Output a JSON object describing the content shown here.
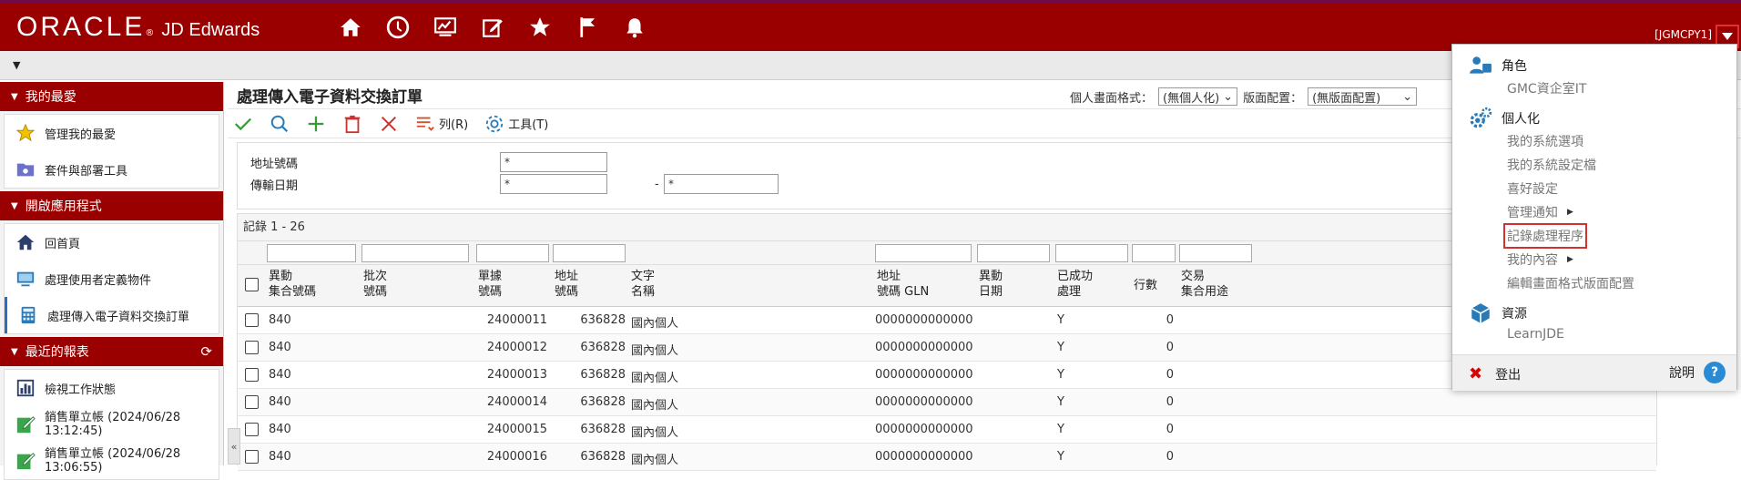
{
  "header": {
    "logo_oracle": "ORACLE",
    "logo_reg": "®",
    "logo_product": "JD Edwards",
    "environment": "[JGMCPY1]",
    "nav_icons": [
      "home-icon",
      "clock-icon",
      "monitor-chart-icon",
      "edit-icon",
      "star-icon",
      "flag-icon",
      "bell-icon"
    ]
  },
  "sidebar": {
    "favorites": {
      "title": "我的最愛",
      "items": [
        {
          "label": "管理我的最愛",
          "icon": "star-icon"
        },
        {
          "label": "套件與部署工具",
          "icon": "folder-icon"
        }
      ]
    },
    "open_apps": {
      "title": "開啟應用程式",
      "items": [
        {
          "label": "回首頁",
          "icon": "home-icon"
        },
        {
          "label": "處理使用者定義物件",
          "icon": "monitor-icon"
        },
        {
          "label": "處理傳入電子資料交換訂單",
          "icon": "calculator-icon"
        }
      ]
    },
    "recent_reports": {
      "title": "最近的報表",
      "items": [
        {
          "label": "檢視工作狀態",
          "icon": "bar-chart-icon"
        },
        {
          "label": "銷售單立帳 (2024/06/28 13:12:45)",
          "icon": "edit-report-icon"
        },
        {
          "label": "銷售單立帳 (2024/06/28 13:06:55)",
          "icon": "edit-report-icon"
        }
      ]
    }
  },
  "main": {
    "title": "處理傳入電子資料交換訂單",
    "personal_format_label": "個人畫面格式：",
    "personal_format_value": "(無個人化)",
    "layout_label": "版面配置：",
    "layout_value": "(無版面配置)",
    "toolbar": {
      "row_label": "列(R)",
      "tools_label": "工具(T)"
    },
    "filters": {
      "address_label": "地址號碼",
      "address_value": "*",
      "date_label": "傳輸日期",
      "date_from": "*",
      "date_to": "*",
      "dash": "-"
    },
    "records": "記錄 1 - 26",
    "columns": [
      "異動\n集合號碼",
      "批次\n號碼",
      "單據\n號碼",
      "地址\n號碼",
      "文字\n名稱",
      "地址\n號碼 GLN",
      "異動\n日期",
      "已成功\n處理",
      "行數",
      "交易\n集合用途"
    ],
    "rows": [
      [
        "840",
        "",
        "24000011",
        "636828",
        "國內個人",
        "0000000000000",
        "",
        "Y",
        "0",
        ""
      ],
      [
        "840",
        "",
        "24000012",
        "636828",
        "國內個人",
        "0000000000000",
        "",
        "Y",
        "0",
        ""
      ],
      [
        "840",
        "",
        "24000013",
        "636828",
        "國內個人",
        "0000000000000",
        "",
        "Y",
        "0",
        ""
      ],
      [
        "840",
        "",
        "24000014",
        "636828",
        "國內個人",
        "0000000000000",
        "",
        "Y",
        "0",
        ""
      ],
      [
        "840",
        "",
        "24000015",
        "636828",
        "國內個人",
        "0000000000000",
        "",
        "Y",
        "0",
        ""
      ],
      [
        "840",
        "",
        "24000016",
        "636828",
        "國內個人",
        "0000000000000",
        "",
        "Y",
        "0",
        ""
      ]
    ]
  },
  "menu": {
    "role_title": "角色",
    "role_value": "GMC資企室IT",
    "personalize_title": "個人化",
    "personalize_items": [
      "我的系統選項",
      "我的系統設定檔",
      "喜好設定",
      "管理通知",
      "記錄處理程序",
      "我的內容",
      "編輯畫面格式版面配置"
    ],
    "resources_title": "資源",
    "resources_value": "LearnJDE",
    "logout": "登出",
    "help": "說明",
    "help_glyph": "?"
  },
  "colors": {
    "brand": "#9b0000",
    "accent": "#2a6ebb",
    "highlight": "#d43030"
  }
}
